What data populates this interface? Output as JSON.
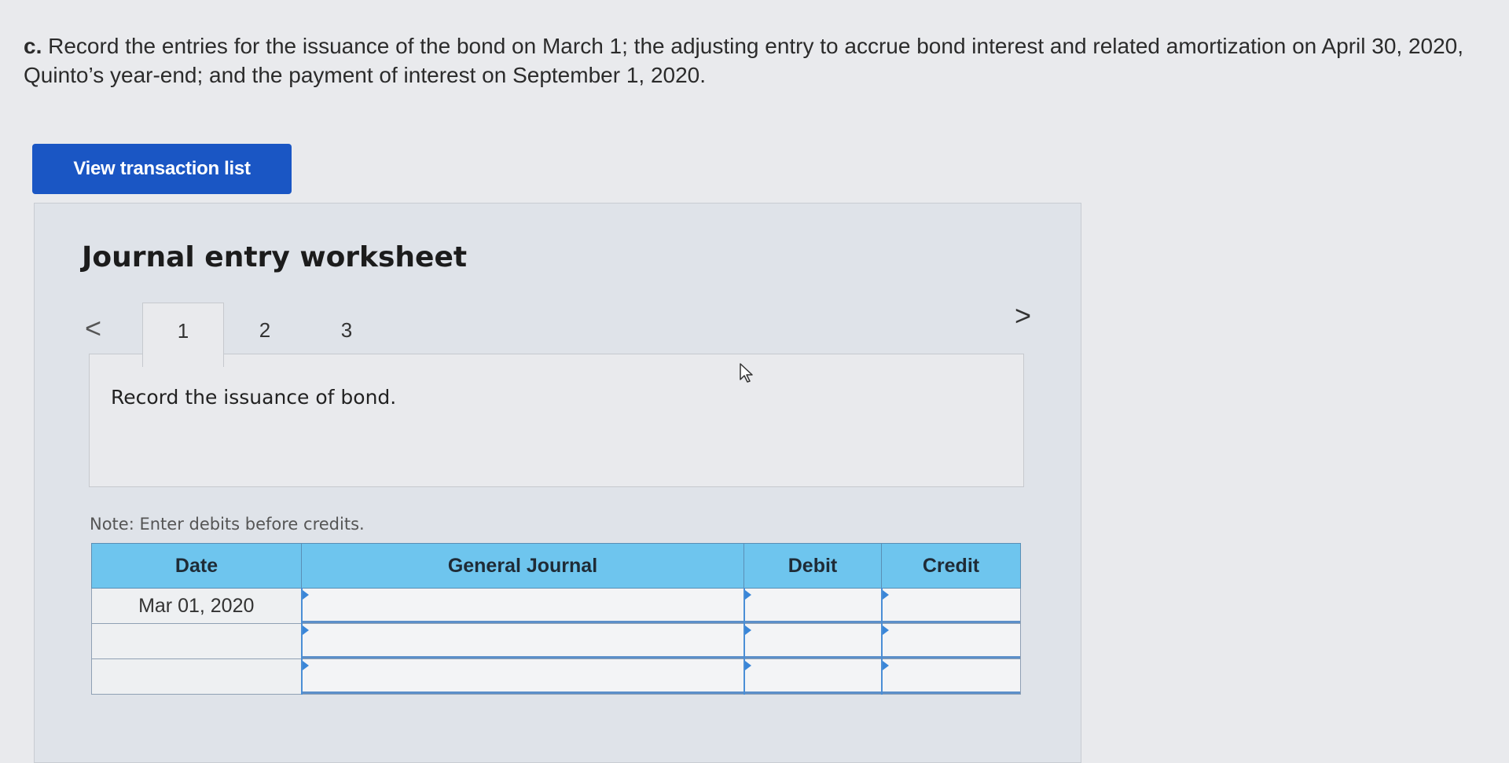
{
  "question": {
    "prefix": "c.",
    "text": " Record the entries for the issuance of the bond on March 1; the adjusting entry to accrue bond interest and related amortization on April 30, 2020, Quinto’s year-end; and the payment of interest on September 1, 2020."
  },
  "buttons": {
    "view_transaction_list": "View transaction list"
  },
  "worksheet": {
    "title": "Journal entry worksheet",
    "nav_prev": "<",
    "nav_next": ">",
    "tabs": [
      {
        "label": "1",
        "active": true
      },
      {
        "label": "2",
        "active": false
      },
      {
        "label": "3",
        "active": false
      }
    ],
    "instruction": "Record the issuance of bond.",
    "note": "Note: Enter debits before credits."
  },
  "journal": {
    "headers": {
      "date": "Date",
      "general_journal": "General Journal",
      "debit": "Debit",
      "credit": "Credit"
    },
    "rows": [
      {
        "date": "Mar 01, 2020",
        "account": "",
        "debit": "",
        "credit": ""
      },
      {
        "date": "",
        "account": "",
        "debit": "",
        "credit": ""
      },
      {
        "date": "",
        "account": "",
        "debit": "",
        "credit": ""
      }
    ]
  },
  "colors": {
    "button_blue": "#1a56c4",
    "header_blue": "#6ec5ee",
    "input_accent": "#4a8ed6"
  }
}
